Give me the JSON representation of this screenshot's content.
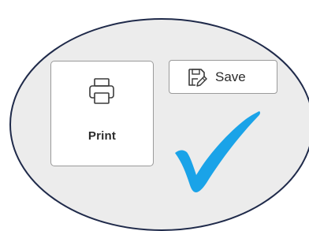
{
  "buttons": {
    "print_label": "Print",
    "save_label": "Save"
  },
  "icons": {
    "print": "printer-icon",
    "save": "save-as-icon",
    "check": "checkmark-icon"
  },
  "colors": {
    "ellipse_fill": "#ececec",
    "ellipse_stroke": "#1f2a4a",
    "checkmark": "#1aa3e8",
    "button_border": "#9a9a9a",
    "text": "#2b2b2b"
  }
}
